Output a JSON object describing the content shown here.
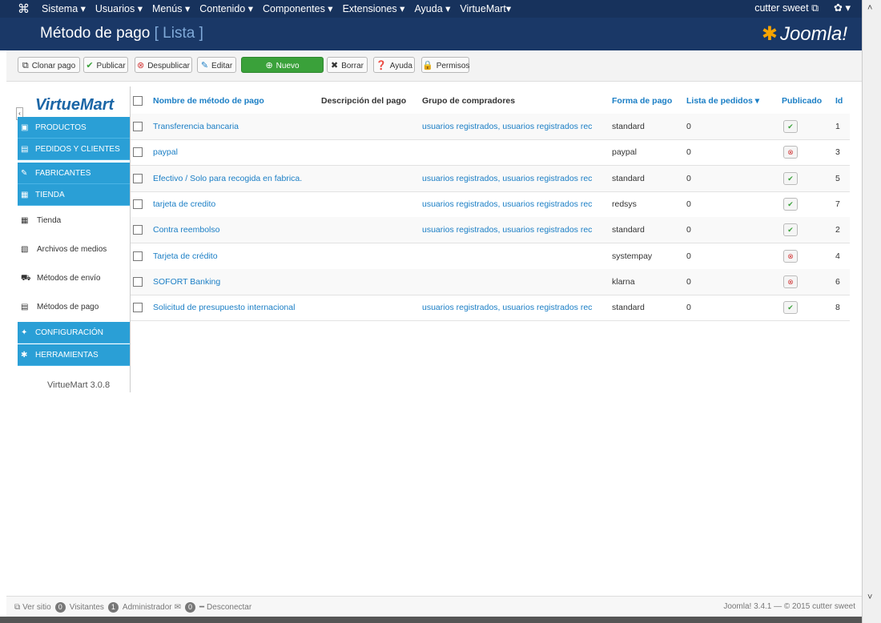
{
  "topnav": {
    "menu": [
      "Sistema ▾",
      "Usuarios ▾",
      "Menús ▾",
      "Contenido ▾",
      "Componentes ▾",
      "Extensiones ▾",
      "Ayuda ▾",
      "VirtueMart▾"
    ],
    "user": "cutter sweet ⧉",
    "gear": "✿ ▾"
  },
  "header": {
    "title": "Método de pago",
    "subtitle": "[ Lista ]",
    "logo": "Joomla!"
  },
  "toolbar": [
    {
      "label": "Clonar pago",
      "icon": "⧉"
    },
    {
      "label": "Publicar",
      "icon": "✔"
    },
    {
      "label": "Despublicar",
      "icon": "⊗"
    },
    {
      "label": "Editar",
      "icon": "✎"
    },
    {
      "label": "Nuevo",
      "icon": "⊕"
    },
    {
      "label": "Borrar",
      "icon": "✖"
    },
    {
      "label": "Ayuda",
      "icon": "❓"
    },
    {
      "label": "Permisos",
      "icon": "🔒"
    }
  ],
  "sidebar": {
    "logo": "VirtueMart",
    "items": [
      {
        "label": "Productos",
        "type": "blue"
      },
      {
        "label": "Pedidos y Clientes",
        "type": "blue"
      },
      {
        "label": "Fabricantes",
        "type": "blue"
      },
      {
        "label": "Tienda",
        "type": "blue"
      },
      {
        "label": "Tienda",
        "type": "white"
      },
      {
        "label": "Archivos de medios",
        "type": "white"
      },
      {
        "label": "Métodos de envío",
        "type": "white"
      },
      {
        "label": "Métodos de pago",
        "type": "white"
      },
      {
        "label": "Configuración",
        "type": "blue"
      },
      {
        "label": "Herramientas",
        "type": "blue"
      }
    ],
    "version": "VirtueMart 3.0.8"
  },
  "table": {
    "headers": [
      "Nombre de método de pago",
      "Descripción del pago",
      "Grupo de compradores",
      "Forma de pago",
      "Lista de pedidos ▾",
      "Publicado",
      "Id"
    ],
    "rows": [
      {
        "name": "Transferencia bancaria",
        "desc": "",
        "group": "usuarios registrados, usuarios registrados rec",
        "form": "standard",
        "list": "0",
        "published": true,
        "id": "1"
      },
      {
        "name": "paypal",
        "desc": "",
        "group": "",
        "form": "paypal",
        "list": "0",
        "published": false,
        "id": "3"
      },
      {
        "name": "Efectivo / Solo para recogida en fabrica.",
        "desc": "",
        "group": "usuarios registrados, usuarios registrados rec",
        "form": "standard",
        "list": "0",
        "published": true,
        "id": "5"
      },
      {
        "name": "tarjeta de credito",
        "desc": "",
        "group": "usuarios registrados, usuarios registrados rec",
        "form": "redsys",
        "list": "0",
        "published": true,
        "id": "7"
      },
      {
        "name": "Contra reembolso",
        "desc": "",
        "group": "usuarios registrados, usuarios registrados rec",
        "form": "standard",
        "list": "0",
        "published": true,
        "id": "2"
      },
      {
        "name": "Tarjeta de crédito",
        "desc": "",
        "group": "",
        "form": "systempay",
        "list": "0",
        "published": false,
        "id": "4"
      },
      {
        "name": "SOFORT Banking",
        "desc": "",
        "group": "",
        "form": "klarna",
        "list": "0",
        "published": false,
        "id": "6"
      },
      {
        "name": "Solicitud de presupuesto internacional",
        "desc": "",
        "group": "usuarios registrados, usuarios registrados rec",
        "form": "standard",
        "list": "0",
        "published": true,
        "id": "8"
      }
    ]
  },
  "footer": {
    "view_site": "Ver sitio",
    "visitors_count": "0",
    "visitors_label": "Visitantes",
    "admin_count": "1",
    "admin_label": "Administrador",
    "msg_count": "0",
    "logout": "Desconectar",
    "right": "Joomla! 3.4.1 — © 2015 cutter sweet"
  }
}
